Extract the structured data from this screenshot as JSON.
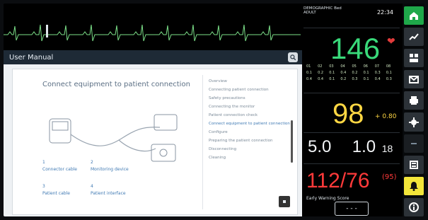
{
  "manual": {
    "header_title": "User Manual"
  },
  "doc": {
    "title": "Connect equipment to patient connection",
    "captions": {
      "c1_num": "1",
      "c1_text": "Connector cable",
      "c2_num": "2",
      "c2_text": "Monitoring device",
      "c3_num": "3",
      "c3_text": "Patient cable",
      "c4_num": "4",
      "c4_text": "Patient interface"
    },
    "toc": [
      "Overview",
      "Connecting patient connection",
      "Safety precautions",
      "Connecting the monitor",
      "Patient connection check",
      "Connect equipment to patient connection",
      "Configure",
      "Preparing the patient connection",
      "Disconnecting",
      "Cleaning"
    ],
    "toc_active_index": 5
  },
  "patient": {
    "line1": "DEMOGRAPHIC Bed",
    "line2": "ADULT",
    "time": "22:34"
  },
  "vitals": {
    "hr": "146",
    "spo2": "98",
    "spo2_extra": "+ 0.80",
    "co2_left": "5.0",
    "co2_right": "1.0",
    "co2_small": "18",
    "nibp": "112/76",
    "nibp_small": "(95)",
    "warning_title": "Early Warning Score",
    "warning_value": "- - -"
  },
  "toolbar": {
    "icons": [
      "home-icon",
      "trend-icon",
      "layout-icon",
      "mail-icon",
      "printer-icon",
      "settings-icon",
      "blank-icon",
      "list-icon",
      "alarm-icon",
      "info-icon"
    ]
  },
  "colors": {
    "hr": "#39d97a",
    "spo2": "#ffd743",
    "nibp": "#ff3a3a",
    "co2": "#f2f4f6",
    "accent": "#1fa84a",
    "alarm": "#f2e53a"
  }
}
